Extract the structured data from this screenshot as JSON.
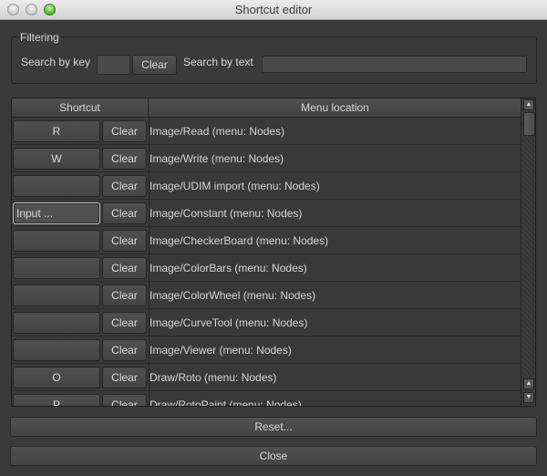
{
  "window": {
    "title": "Shortcut editor"
  },
  "filtering": {
    "group_title": "Filtering",
    "search_by_key_label": "Search by key",
    "search_by_key_value": "",
    "clear_label": "Clear",
    "search_by_text_label": "Search by text",
    "search_by_text_value": ""
  },
  "table": {
    "columns": [
      "Shortcut",
      "Menu location"
    ],
    "clear_label": "Clear",
    "rows": [
      {
        "shortcut": "R",
        "location": "Image/Read (menu: Nodes)"
      },
      {
        "shortcut": "W",
        "location": "Image/Write (menu: Nodes)"
      },
      {
        "shortcut": "",
        "location": "Image/UDIM import (menu: Nodes)"
      },
      {
        "shortcut": "Input ...",
        "location": "Image/Constant (menu: Nodes)"
      },
      {
        "shortcut": "",
        "location": "Image/CheckerBoard (menu: Nodes)"
      },
      {
        "shortcut": "",
        "location": "Image/ColorBars (menu: Nodes)"
      },
      {
        "shortcut": "",
        "location": "Image/ColorWheel (menu: Nodes)"
      },
      {
        "shortcut": "",
        "location": "Image/CurveTool (menu: Nodes)"
      },
      {
        "shortcut": "",
        "location": "Image/Viewer (menu: Nodes)"
      },
      {
        "shortcut": "O",
        "location": "Draw/Roto (menu: Nodes)"
      },
      {
        "shortcut": "P",
        "location": "Draw/RotoPaint (menu: Nodes)"
      }
    ]
  },
  "buttons": {
    "reset": "Reset...",
    "close": "Close"
  },
  "icons": {
    "scroll_up": "chevron-up-icon",
    "scroll_down": "chevron-down-icon"
  }
}
